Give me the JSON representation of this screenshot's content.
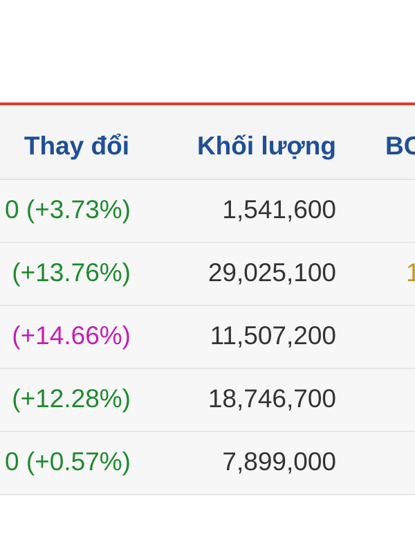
{
  "table": {
    "headers": {
      "change": "Thay đổi",
      "volume": "Khối lượng",
      "next": "BC"
    },
    "rows": [
      {
        "change": "0 (+3.73%)",
        "change_status": "up",
        "volume": "1,541,600",
        "next": ""
      },
      {
        "change": "(+13.76%)",
        "change_status": "up",
        "volume": "29,025,100",
        "next": "1"
      },
      {
        "change": "(+14.66%)",
        "change_status": "ceiling",
        "volume": "11,507,200",
        "next": ""
      },
      {
        "change": "(+12.28%)",
        "change_status": "up",
        "volume": "18,746,700",
        "next": ""
      },
      {
        "change": "0 (+0.57%)",
        "change_status": "up",
        "volume": "7,899,000",
        "next": ""
      }
    ]
  },
  "colors": {
    "accent_rule": "#e53a2f",
    "header_text": "#1f4f96",
    "up": "#1e8a2e",
    "ceiling": "#c21fb8",
    "volume_text": "#333333",
    "partial_col": "#c7961a"
  }
}
